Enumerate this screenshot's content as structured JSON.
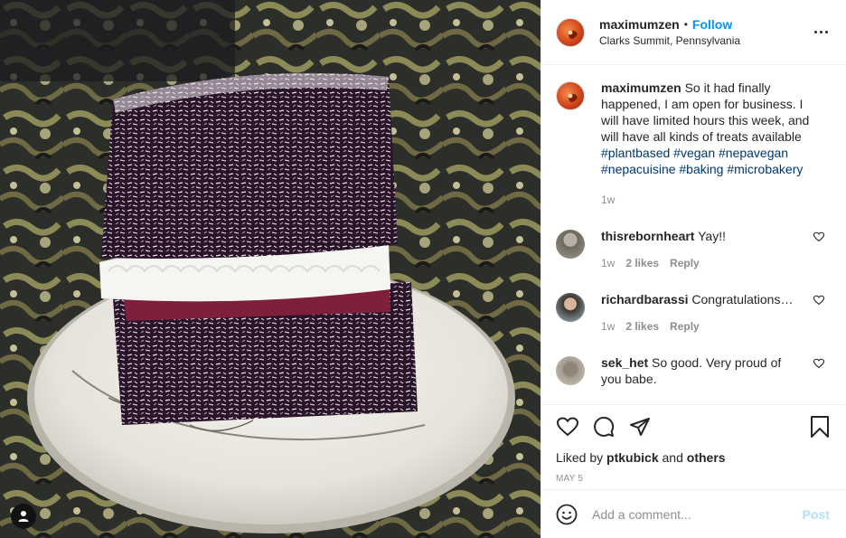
{
  "header": {
    "username": "maximumzen",
    "separator": "•",
    "follow_label": "Follow",
    "location": "Clarks Summit, Pennsylvania",
    "more_icon": "more-options-icon"
  },
  "caption": {
    "username": "maximumzen",
    "text": "So it had finally happened, I am open for business. I will have limited hours this week, and will have all kinds of treats available",
    "hashtags": "#plantbased #vegan #nepavegan #nepacuisine #baking #microbakery",
    "time": "1w"
  },
  "comments": [
    {
      "username": "thisrebornheart",
      "text": "Yay!!",
      "time": "1w",
      "likes": "2 likes",
      "reply": "Reply"
    },
    {
      "username": "richardbarassi",
      "text": "Congratulations…",
      "time": "1w",
      "likes": "2 likes",
      "reply": "Reply"
    },
    {
      "username": "sek_het",
      "text": "So good. Very proud of you babe.",
      "time": "",
      "likes": "",
      "reply": ""
    }
  ],
  "liked_by": {
    "prefix": "Liked by",
    "user": "ptkubick",
    "conj": "and",
    "others": "others"
  },
  "date": "MAY 5",
  "add_comment": {
    "placeholder": "Add a comment...",
    "post_label": "Post"
  },
  "colors": {
    "link": "#0095f6",
    "hashtag": "#00376b",
    "muted": "#8e8e8e",
    "post_disabled": "#b2dffc"
  }
}
